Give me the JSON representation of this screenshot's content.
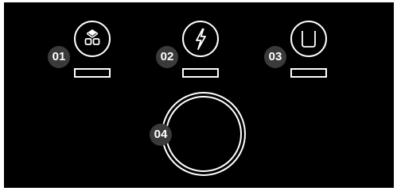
{
  "controls": [
    {
      "badge": "01",
      "icon": "ice-cubes-icon",
      "control": "ice-maker-button"
    },
    {
      "badge": "02",
      "icon": "lightning-bolt-icon",
      "control": "power-button"
    },
    {
      "badge": "03",
      "icon": "cup-icon",
      "control": "dispenser-button"
    }
  ],
  "dial": {
    "badge": "04"
  },
  "colors": {
    "background": "#000000",
    "line": "#ffffff",
    "badge": "#3a3a3a"
  }
}
